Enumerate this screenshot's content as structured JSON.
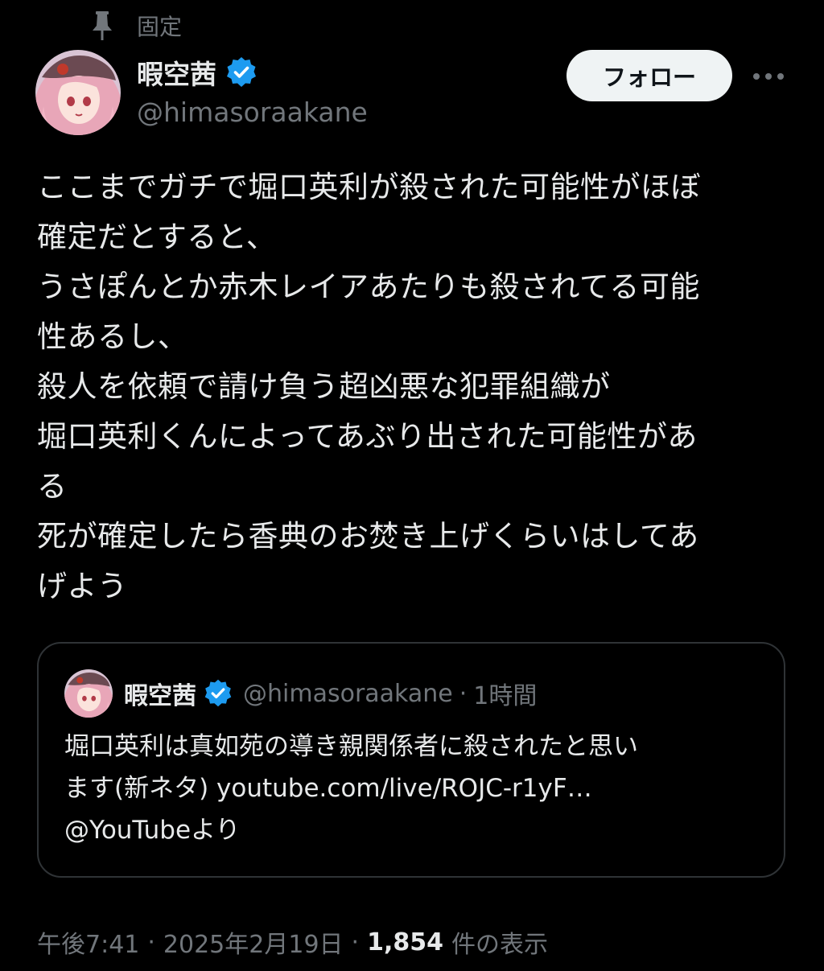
{
  "pinned": {
    "label": "固定",
    "icon": "pin-icon"
  },
  "author": {
    "name": "暇空茜",
    "handle": "@himasoraakane",
    "verified": true,
    "verified_color": "#1d9bf0"
  },
  "actions": {
    "follow_label": "フォロー",
    "more_icon": "more-dots-icon"
  },
  "tweet": {
    "lines": [
      "ここまでガチで堀口英利が殺された可能性がほぼ",
      "確定だとすると、",
      "うさぽんとか赤木レイアあたりも殺されてる可能",
      "性あるし、",
      "殺人を依頼で請け負う超凶悪な犯罪組織が",
      "堀口英利くんによってあぶり出された可能性があ",
      "る",
      "死が確定したら香典のお焚き上げくらいはしてあ",
      "げよう"
    ]
  },
  "quote": {
    "name": "暇空茜",
    "handle": "@himasoraakane",
    "separator": "·",
    "time": "1時間",
    "lines": [
      "堀口英利は真如苑の導き親関係者に殺されたと思い",
      "ます(新ネタ) youtube.com/live/ROJC-r1yF…",
      "@YouTubeより"
    ]
  },
  "meta": {
    "time": "午後7:41",
    "separator": "·",
    "date": "2025年2月19日",
    "view_count": "1,854",
    "view_label": "件の表示"
  },
  "colors": {
    "background": "#000000",
    "text": "#e7e9ea",
    "secondary": "#71767b",
    "border": "#2f3336",
    "follow_bg": "#eff3f4"
  }
}
